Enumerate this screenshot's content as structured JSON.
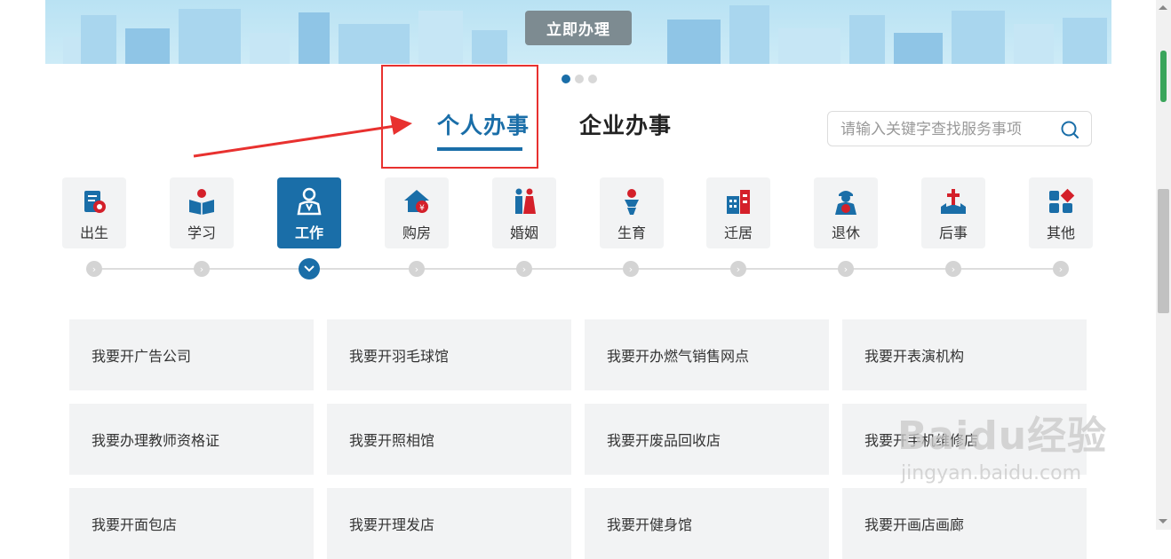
{
  "banner": {
    "button_label": "立即办理"
  },
  "carousel": {
    "total": 3,
    "active": 0
  },
  "tabs": {
    "personal": "个人办事",
    "enterprise": "企业办事"
  },
  "search": {
    "placeholder": "请输入关键字查找服务事项"
  },
  "categories": [
    {
      "label": "出生",
      "icon": "birth-certificate-icon"
    },
    {
      "label": "学习",
      "icon": "study-icon"
    },
    {
      "label": "工作",
      "icon": "work-icon",
      "active": true
    },
    {
      "label": "购房",
      "icon": "house-purchase-icon"
    },
    {
      "label": "婚姻",
      "icon": "marriage-icon"
    },
    {
      "label": "生育",
      "icon": "childbirth-icon"
    },
    {
      "label": "迁居",
      "icon": "relocation-icon"
    },
    {
      "label": "退休",
      "icon": "retirement-icon"
    },
    {
      "label": "后事",
      "icon": "funeral-icon"
    },
    {
      "label": "其他",
      "icon": "other-icon"
    }
  ],
  "services": [
    [
      "我要开广告公司",
      "我要开羽毛球馆",
      "我要开办燃气销售网点",
      "我要开表演机构"
    ],
    [
      "我要办理教师资格证",
      "我要开照相馆",
      "我要开废品回收店",
      "我要开手机维修店"
    ],
    [
      "我要开面包店",
      "我要开理发店",
      "我要开健身馆",
      "我要开画店画廊"
    ]
  ],
  "watermark": {
    "brand": "Baidu经验",
    "url": "jingyan.baidu.com"
  },
  "colors": {
    "accent": "#1a6ea8",
    "highlight": "#e8312f",
    "card_bg": "#f2f3f4"
  }
}
